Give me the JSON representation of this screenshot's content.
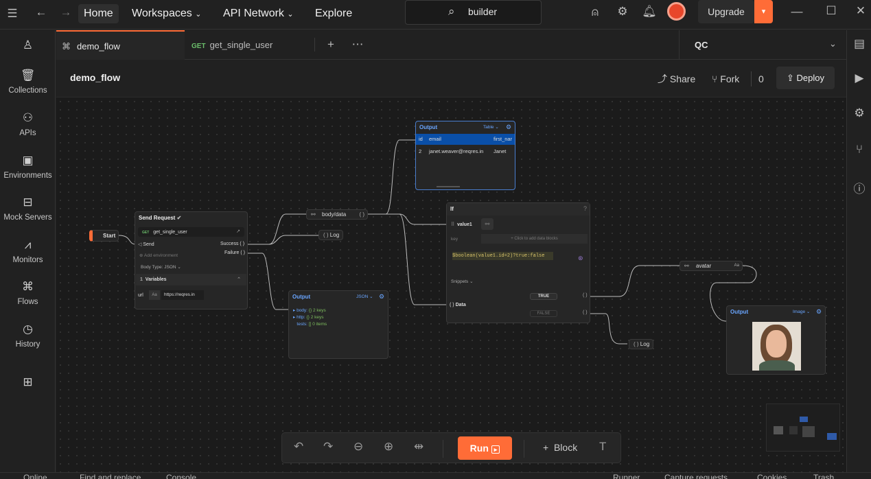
{
  "nav": {
    "home": "Home",
    "workspaces": "Workspaces",
    "api_network": "API Network",
    "explore": "Explore",
    "search_value": "builder",
    "upgrade": "Upgrade"
  },
  "rail": {
    "collections": "Collections",
    "apis": "APIs",
    "environments": "Environments",
    "mock_servers": "Mock Servers",
    "monitors": "Monitors",
    "flows": "Flows",
    "history": "History"
  },
  "tabs": {
    "tab1": "demo_flow",
    "tab2_method": "GET",
    "tab2": "get_single_user",
    "environment": "QC"
  },
  "header": {
    "title": "demo_flow",
    "share": "Share",
    "fork": "Fork",
    "fork_count": "0",
    "deploy": "Deploy"
  },
  "canvas": {
    "start": "Start",
    "send_request": {
      "title": "Send Request",
      "method": "GET",
      "request": "get_single_user",
      "send": "Send",
      "success": "Success",
      "failure": "Failure",
      "add_env": "Add environment",
      "body_type": "Body Type: JSON",
      "variables_count": "1",
      "variables": "Variables",
      "var_key": "url",
      "var_type": "Aa",
      "var_value": "https://reqres.in"
    },
    "select_body": "body/data",
    "log1": "Log",
    "log2": "Log",
    "output_table": {
      "title": "Output",
      "mode": "Table",
      "headers": [
        "id",
        "email",
        "first_nar"
      ],
      "row": [
        "2",
        "janet.weaver@reqres.in",
        "Janet"
      ]
    },
    "output_json": {
      "title": "Output",
      "mode": "JSON",
      "lines": [
        {
          "key": "body:",
          "type": "{}",
          "value": "2 keys"
        },
        {
          "key": "http:",
          "type": "{}",
          "value": "2 keys"
        },
        {
          "key": "tests:",
          "type": "[]",
          "value": "0 items"
        }
      ]
    },
    "if_block": {
      "title": "If",
      "value_name": "value1",
      "key_label": "key",
      "click_hint": "Click to add data blocks",
      "expression": "$boolean(value1.id=2)?true:false",
      "snippets": "Snippets",
      "data": "Data",
      "true_label": "TRUE",
      "false_label": "FALSE"
    },
    "select_avatar": "avatar",
    "avatar_type": "Aa",
    "output_image": {
      "title": "Output",
      "mode": "Image"
    },
    "toolbar": {
      "run": "Run",
      "block": "Block"
    }
  },
  "status": {
    "online": "Online",
    "find": "Find and replace",
    "console": "Console",
    "runner": "Runner",
    "capture": "Capture requests",
    "cookies": "Cookies",
    "trash": "Trash"
  },
  "colors": {
    "accent": "#ff6c37",
    "background": "#1b1b1b",
    "selection": "#0a4fa8"
  }
}
